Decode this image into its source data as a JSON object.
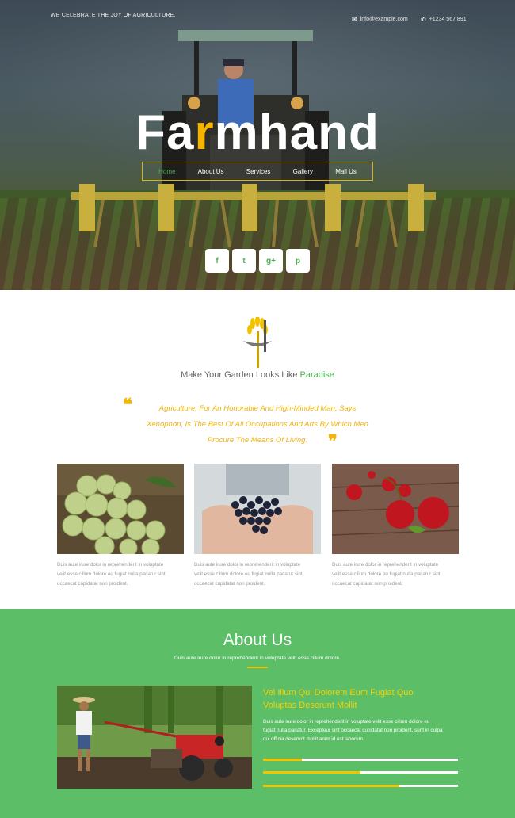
{
  "header": {
    "tagline": "WE CELEBRATE THE JOY OF AGRICULTURE.",
    "email": "info@example.com",
    "phone": "+1234 567 891"
  },
  "logo": {
    "part1": "Fa",
    "part2": "r",
    "part3": "mhand"
  },
  "nav": [
    "Home",
    "About Us",
    "Services",
    "Gallery",
    "Mail Us"
  ],
  "social": [
    "f",
    "t",
    "g+",
    "p"
  ],
  "mission": {
    "title_prefix": "Make Your Garden Looks Like ",
    "title_highlight": "Paradise",
    "quote_line1": "Agriculture, For An Honorable And High-Minded Man, Says",
    "quote_line2": "Xenophon, Is The Best Of All Occupations And Arts By Which Men",
    "quote_line3": "Procure The Means Of Living."
  },
  "cards": [
    {
      "text1": "Duis aute irure dolor in reprehenderit in voluptate",
      "text2": "velit esse cillum dolore eu fugiat nulla pariatur sint",
      "text3": "occaecat cupidatat non proident."
    },
    {
      "text1": "Duis aute irure dolor in reprehenderit in voluptate",
      "text2": "velit esse cillum dolore eu fugiat nulla pariatur sint",
      "text3": "occaecat cupidatat non proident."
    },
    {
      "text1": "Duis aute irure dolor in reprehenderit in voluptate",
      "text2": "velit esse cillum dolore eu fugiat nulla pariatur sint",
      "text3": "occaecat cupidatat non proident."
    }
  ],
  "about": {
    "title": "About Us",
    "subtitle": "Duis aute irure dolor in reprehenderit in voluptate velit esse cillum dolore.",
    "heading_line1": "Vel Illum Qui Dolorem Eum Fugiat Quo",
    "heading_line2": "Voluptas Deserunt Mollit",
    "text_line1": "Duis aute irure dolor in reprehenderit in voluptate velit esse cillum dolore eu",
    "text_line2": "fugiat nulla pariatur. Excepteur sint occaecat cupidatat non proident, sunt in culpa",
    "text_line3": "qui officia deserunt mollit anim id est laborum.",
    "progress": [
      0.2,
      0.5,
      0.7
    ]
  },
  "colors": {
    "accent": "#4caf50",
    "yellow": "#f5c400",
    "about_bg": "#5cbe67"
  }
}
